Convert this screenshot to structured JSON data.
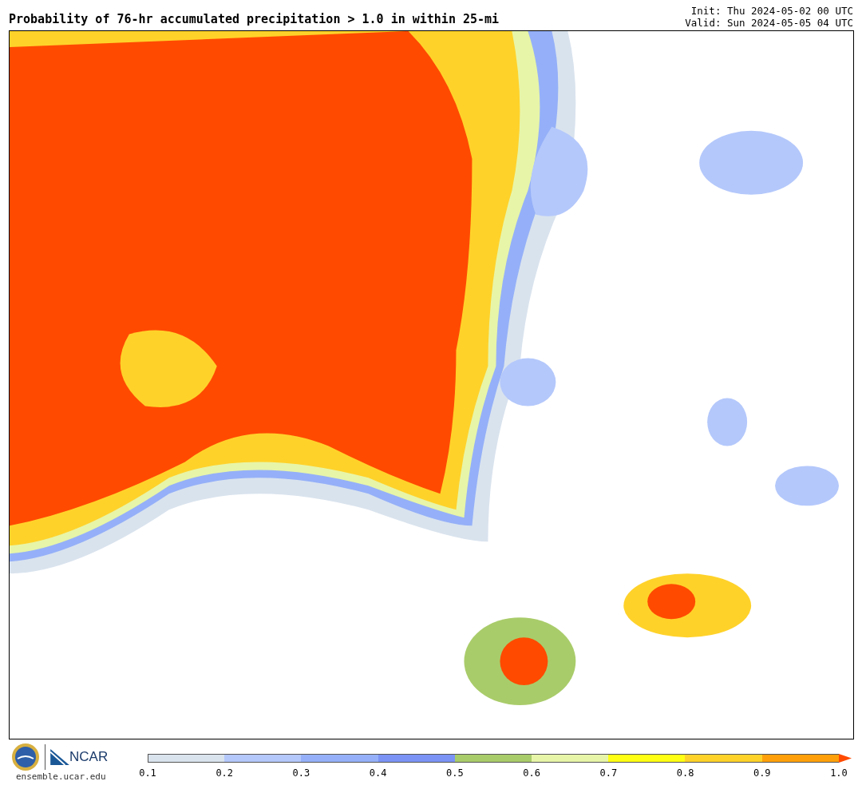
{
  "header": {
    "title": "Probability of 76-hr accumulated precipitation > 1.0 in within 25-mi",
    "init": "Init: Thu 2024-05-02 00 UTC",
    "valid": "Valid: Sun 2024-05-05 04 UTC"
  },
  "footer": {
    "logo_text": "NCAR",
    "site": "ensemble.ucar.edu"
  },
  "colorbar": {
    "segments": [
      {
        "color": "#d9e3ee"
      },
      {
        "color": "#b4c8fb"
      },
      {
        "color": "#95b0f8"
      },
      {
        "color": "#7b93f4"
      },
      {
        "color": "#a9cc6a"
      },
      {
        "color": "#e7f5a8"
      },
      {
        "color": "#ffff14"
      },
      {
        "color": "#ffd22a"
      },
      {
        "color": "#ffa00a"
      },
      {
        "kind": "arrow",
        "color": "#ff4a00"
      }
    ],
    "ticks": [
      "0.1",
      "0.2",
      "0.3",
      "0.4",
      "0.5",
      "0.6",
      "0.7",
      "0.8",
      "0.9",
      "1.0"
    ]
  }
}
